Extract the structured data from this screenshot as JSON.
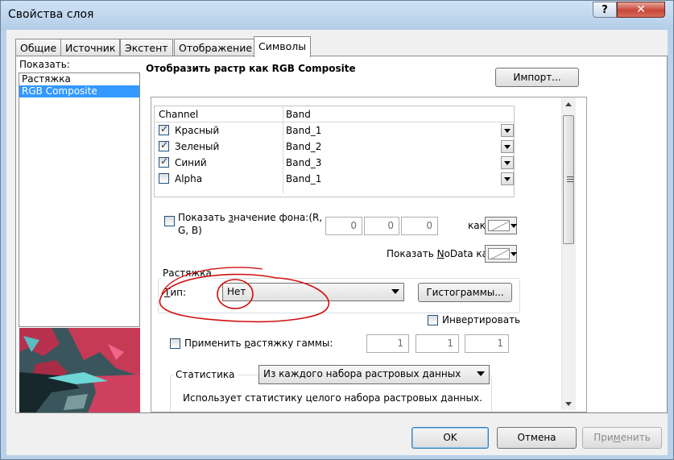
{
  "window": {
    "title": "Свойства слоя",
    "help_label": "?",
    "close_label": "✕"
  },
  "tabs": [
    {
      "label": "Общие"
    },
    {
      "label": "Источник"
    },
    {
      "label": "Экстент"
    },
    {
      "label": "Отображение"
    },
    {
      "label": "Символы",
      "active": true
    }
  ],
  "left_panel": {
    "show_label": "Показать:",
    "items": [
      {
        "label": "Растяжка",
        "selected": false
      },
      {
        "label": "RGB Composite",
        "selected": true
      }
    ]
  },
  "right_panel": {
    "title": "Отобразить растр как RGB Composite",
    "import_button": "Импорт...",
    "channels_table": {
      "headers": {
        "channel": "Channel",
        "band": "Band"
      },
      "rows": [
        {
          "channel": "Красный",
          "band": "Band_1",
          "checked": true
        },
        {
          "channel": "Зеленый",
          "band": "Band_2",
          "checked": true
        },
        {
          "channel": "Синий",
          "band": "Band_3",
          "checked": true
        },
        {
          "channel": "Alpha",
          "band": "Band_1",
          "checked": false
        }
      ]
    },
    "background": {
      "label_a": "Показать ",
      "label_u": "з",
      "label_b": "начение фона:(R,",
      "label_line2": "G, B)",
      "values": [
        "0",
        "0",
        "0"
      ],
      "as_label": "как"
    },
    "nodata": {
      "label_a": "Показать ",
      "label_u": "N",
      "label_b": "oData как"
    },
    "stretch": {
      "group_label": "Растяжка",
      "type_label_u": "Т",
      "type_label_rest": "ип:",
      "type_value": "Нет",
      "histograms_button": "Гистограммы...",
      "invert_label": "Инвертировать",
      "invert_checked": false
    },
    "gamma": {
      "label_a": "Применить ",
      "label_u": "р",
      "label_b": "астяжку гаммы:",
      "checked": false,
      "values": [
        "1",
        "1",
        "1"
      ]
    },
    "statistics": {
      "label": "Статистика",
      "value": "Из каждого набора растровых данных",
      "description": "Использует статистику целого набора растровых данных."
    }
  },
  "footer": {
    "ok": "OK",
    "cancel": "Отмена",
    "apply_a": "При",
    "apply_u": "м",
    "apply_b": "енить"
  },
  "colors": {
    "selection": "#3399ff",
    "annotation": "#d01010",
    "close_button": "#c8473a",
    "titlebar": "#b9d1ea"
  }
}
